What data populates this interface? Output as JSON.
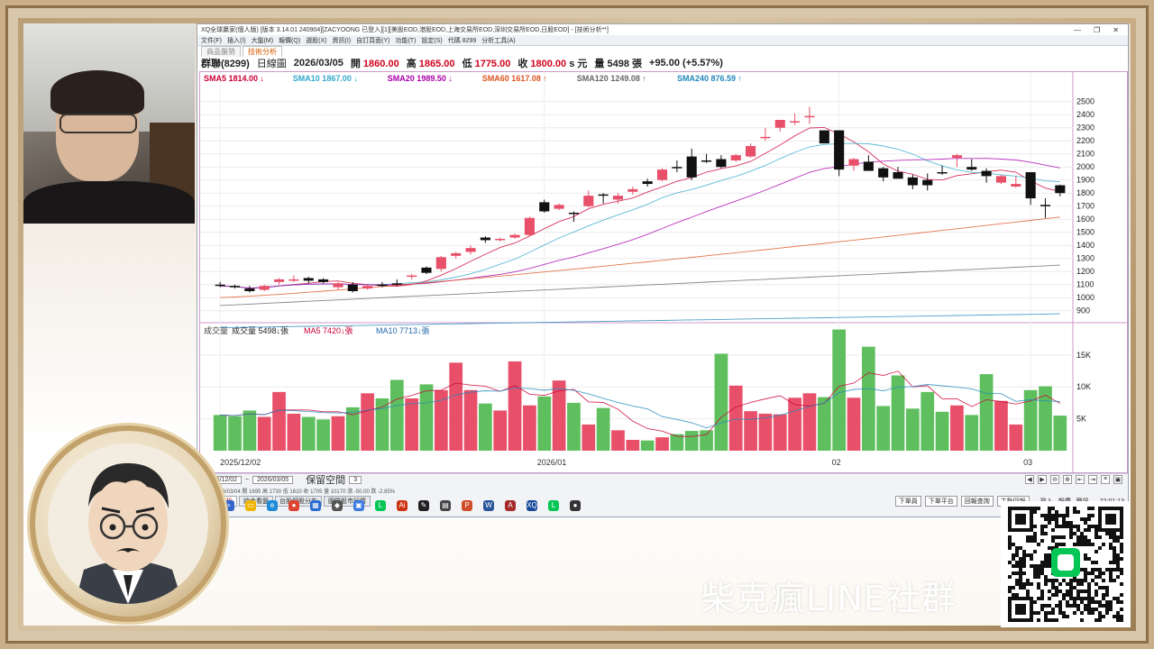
{
  "window": {
    "title": "XQ全球贏家(個人版) [版本 3.14.01 240904][ZACYOONG 已登入][1][美股EOD,港股EOD,上海交易所EOD,深圳交易所EOD,日股EOD] - [技術分析**]",
    "toolbar_items": [
      "文件(F)",
      "插入(I)",
      "大盤(M)",
      "報價(Q)",
      "選股(X)",
      "資訊(I)",
      "自訂頁面(Y)",
      "功能(T)",
      "設定(S)",
      "代碼 8299",
      "分析工具(A)"
    ],
    "tabs": [
      "商品盤勢",
      "技術分析"
    ],
    "active_tab": "技術分析"
  },
  "quote": {
    "symbol": "群聯(8299)",
    "period": "日線圖",
    "date": "2026/03/05",
    "open_label": "開",
    "open": "1860.00",
    "high_label": "高",
    "high": "1865.00",
    "low_label": "低",
    "low": "1775.00",
    "close_label": "收",
    "close": "1800.00",
    "unit": "s 元",
    "volume_label": "量",
    "volume": "5498 張",
    "change": "+95.00 (+5.57%)"
  },
  "indicators": [
    {
      "label": "SMA5",
      "value": "1814.00",
      "dir": "down",
      "color": "#cc0033"
    },
    {
      "label": "SMA10",
      "value": "1867.00",
      "dir": "down",
      "color": "#33aacc"
    },
    {
      "label": "SMA20",
      "value": "1989.50",
      "dir": "down",
      "color": "#aa00aa"
    },
    {
      "label": "SMA60",
      "value": "1617.08",
      "dir": "up",
      "color": "#dd5522"
    },
    {
      "label": "SMA120",
      "value": "1249.08",
      "dir": "up",
      "color": "#666666"
    },
    {
      "label": "SMA240",
      "value": "876.59",
      "dir": "up",
      "color": "#2288bb"
    }
  ],
  "volume_header": {
    "title": "成交量",
    "vol_label": "成交量",
    "vol_value": "5498",
    "vol_unit": "張",
    "ma5_label": "MA5",
    "ma5_value": "7420",
    "ma5_unit": "張",
    "ma10_label": "MA10",
    "ma10_value": "7713",
    "ma10_unit": "張"
  },
  "chart_data": {
    "type": "candlestick",
    "price_axis": {
      "ticks": [
        2500,
        2400,
        2300,
        2200,
        2100,
        2000,
        1900,
        1800,
        1700,
        1600,
        1500,
        1400,
        1300,
        1200,
        1100,
        1000,
        900
      ],
      "range": [
        850,
        2560
      ]
    },
    "volume_axis": {
      "ticks": [
        "15K",
        "10K",
        "5K"
      ],
      "tick_values": [
        15000,
        10000,
        5000
      ],
      "range": [
        0,
        19500
      ]
    },
    "x_labels": [
      "2025/12/02",
      "2026/01",
      "02",
      "03"
    ],
    "x_label_index": [
      0,
      22,
      42,
      55
    ],
    "candles": [
      [
        1100,
        1120,
        1080,
        1090
      ],
      [
        1090,
        1100,
        1070,
        1080
      ],
      [
        1070,
        1090,
        1040,
        1050
      ],
      [
        1060,
        1100,
        1050,
        1090
      ],
      [
        1120,
        1150,
        1100,
        1140
      ],
      [
        1140,
        1170,
        1120,
        1140
      ],
      [
        1150,
        1160,
        1110,
        1130
      ],
      [
        1140,
        1150,
        1110,
        1120
      ],
      [
        1080,
        1120,
        1060,
        1110
      ],
      [
        1100,
        1120,
        1040,
        1050
      ],
      [
        1070,
        1100,
        1060,
        1090
      ],
      [
        1100,
        1120,
        1080,
        1090
      ],
      [
        1110,
        1140,
        1090,
        1100
      ],
      [
        1160,
        1180,
        1140,
        1170
      ],
      [
        1230,
        1240,
        1180,
        1190
      ],
      [
        1220,
        1320,
        1200,
        1310
      ],
      [
        1320,
        1350,
        1300,
        1340
      ],
      [
        1350,
        1400,
        1330,
        1380
      ],
      [
        1460,
        1470,
        1420,
        1440
      ],
      [
        1450,
        1460,
        1430,
        1450
      ],
      [
        1460,
        1490,
        1450,
        1480
      ],
      [
        1480,
        1620,
        1470,
        1610
      ],
      [
        1730,
        1750,
        1650,
        1660
      ],
      [
        1680,
        1720,
        1670,
        1710
      ],
      [
        1650,
        1660,
        1580,
        1640
      ],
      [
        1700,
        1820,
        1690,
        1780
      ],
      [
        1790,
        1800,
        1720,
        1780
      ],
      [
        1750,
        1800,
        1720,
        1780
      ],
      [
        1810,
        1850,
        1790,
        1830
      ],
      [
        1890,
        1910,
        1850,
        1870
      ],
      [
        1900,
        1990,
        1890,
        1980
      ],
      [
        2000,
        2050,
        1960,
        1990
      ],
      [
        2080,
        2140,
        1900,
        1920
      ],
      [
        2050,
        2100,
        2030,
        2040
      ],
      [
        2060,
        2090,
        1990,
        2000
      ],
      [
        2050,
        2100,
        2040,
        2090
      ],
      [
        2080,
        2180,
        2070,
        2160
      ],
      [
        2230,
        2300,
        2200,
        2230
      ],
      [
        2300,
        2360,
        2270,
        2360
      ],
      [
        2340,
        2410,
        2320,
        2350
      ],
      [
        2380,
        2460,
        2330,
        2390
      ],
      [
        2280,
        2280,
        2180,
        2180
      ],
      [
        2280,
        2280,
        1930,
        1980
      ],
      [
        2010,
        2070,
        1970,
        2060
      ],
      [
        2040,
        2090,
        1980,
        1970
      ],
      [
        1990,
        2000,
        1890,
        1920
      ],
      [
        1960,
        2000,
        1940,
        1910
      ],
      [
        1920,
        1940,
        1830,
        1860
      ],
      [
        1900,
        1950,
        1820,
        1860
      ],
      [
        1960,
        2010,
        1940,
        1950
      ],
      [
        2070,
        2100,
        2000,
        2090
      ],
      [
        2000,
        2060,
        1970,
        1980
      ],
      [
        1970,
        1990,
        1880,
        1930
      ],
      [
        1880,
        1940,
        1870,
        1930
      ],
      [
        1850,
        1930,
        1840,
        1870
      ],
      [
        1960,
        1960,
        1710,
        1760
      ],
      [
        1710,
        1760,
        1610,
        1700
      ],
      [
        1860,
        1865,
        1775,
        1800
      ]
    ],
    "volumes": [
      5600,
      5400,
      6300,
      5300,
      9200,
      5800,
      5300,
      4900,
      5400,
      6800,
      9000,
      8200,
      11100,
      8200,
      10400,
      9500,
      13800,
      9500,
      7400,
      6300,
      14000,
      7100,
      8500,
      11000,
      7500,
      4100,
      6700,
      3200,
      1700,
      1600,
      2100,
      2600,
      3100,
      3200,
      15200,
      10200,
      6200,
      5800,
      5700,
      8300,
      9000,
      8400,
      19000,
      8300,
      16300,
      7000,
      11800,
      6600,
      9200,
      6100,
      7100,
      5600,
      12000,
      7800,
      4100,
      9500,
      10100,
      5498
    ],
    "series": [
      {
        "name": "SMA5",
        "color": "#cc0033"
      },
      {
        "name": "SMA10",
        "color": "#33aacc"
      },
      {
        "name": "SMA20",
        "color": "#aa00aa"
      },
      {
        "name": "SMA60",
        "color": "#dd5522"
      },
      {
        "name": "SMA120",
        "color": "#666666"
      },
      {
        "name": "SMA240",
        "color": "#2288bb"
      },
      {
        "name": "MA5",
        "color": "#cc0033"
      },
      {
        "name": "MA10",
        "color": "#2288bb"
      }
    ],
    "colors": {
      "up": "#e8506a",
      "down": "#111111",
      "vol_up": "#e8506a",
      "vol_down": "#5fbf5f",
      "vol_flat": "#555555"
    }
  },
  "bottom": {
    "date_from": "2025/12/02",
    "date_to": "2026/03/05",
    "keep_label": "保留空間",
    "keep_value": "3",
    "sheet_tabs": [
      "技術分析",
      "綜合看盤",
      "台股個股分布",
      "國際股市行情"
    ],
    "active_sheet_tab": "技術分析",
    "status_buttons": [
      "下單員",
      "下單平台",
      "回報查詢",
      "主動回報"
    ],
    "status_right": [
      "登入",
      "報價",
      "簡訊"
    ],
    "clock": "22:01:13",
    "ticker": "群聯 2026/03/04 開 1695 高 1730 低 1610 收 1705 量 10170 漲 -50.00 跌 -2.85%"
  },
  "caption": "柴克瘋LINE社群"
}
